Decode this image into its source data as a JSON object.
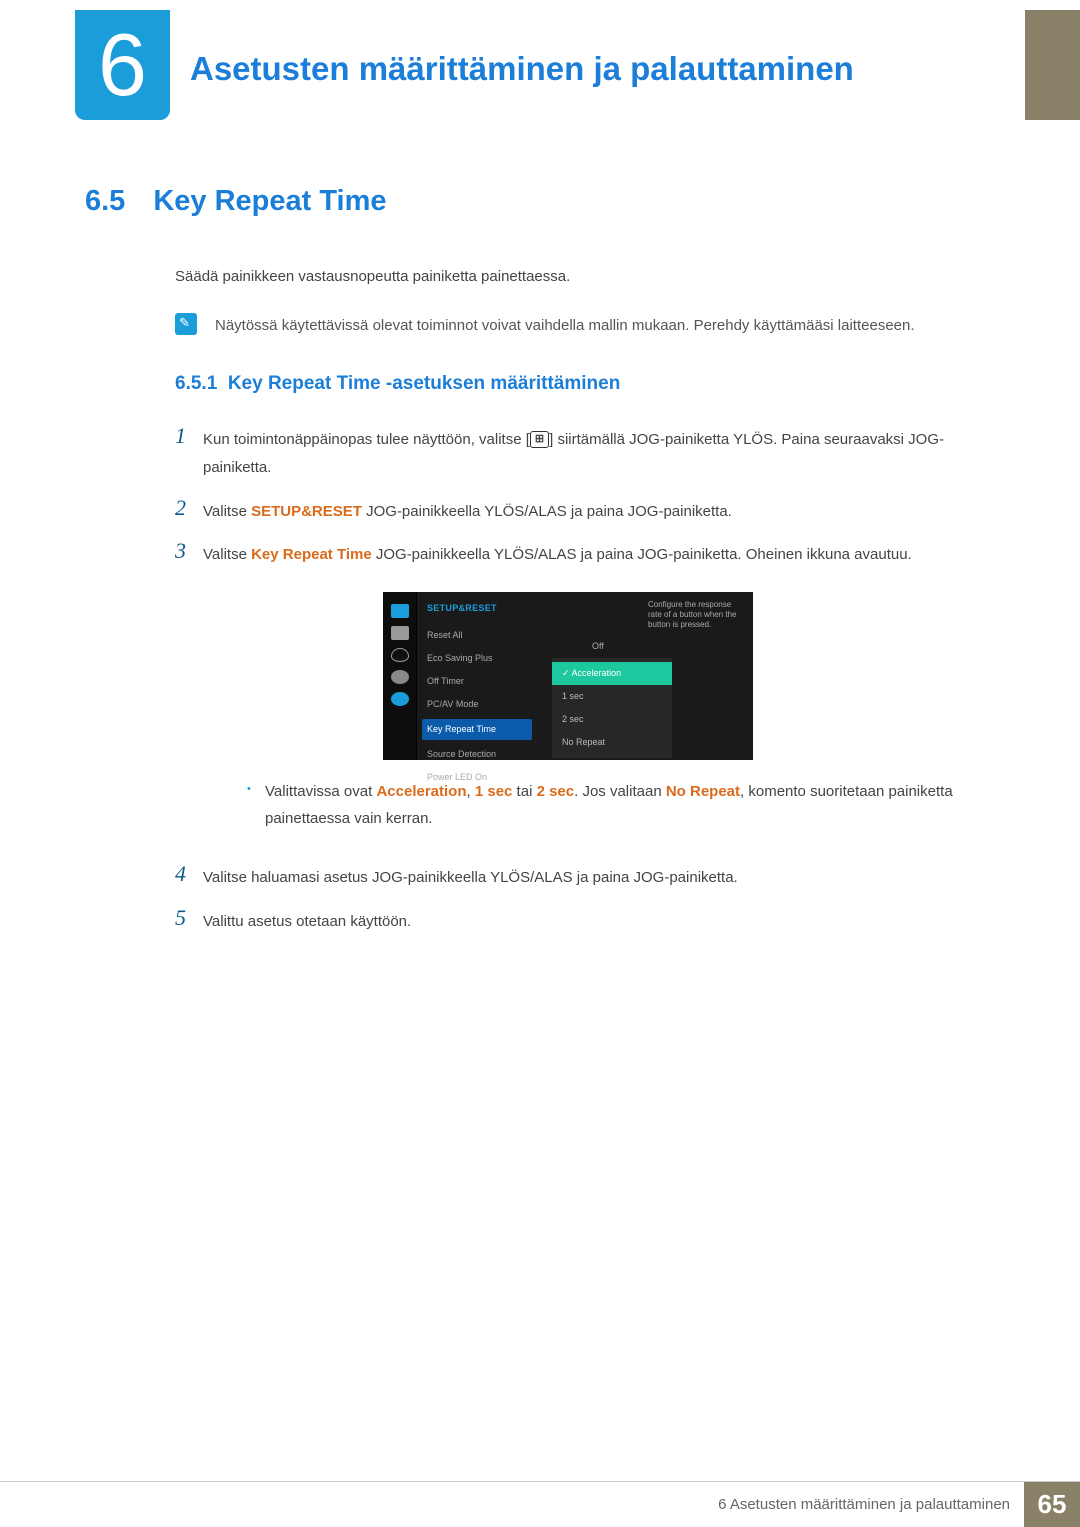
{
  "header": {
    "chapter_number": "6",
    "chapter_title": "Asetusten määrittäminen ja palauttaminen"
  },
  "section": {
    "number": "6.5",
    "title": "Key Repeat Time",
    "intro": "Säädä painikkeen vastausnopeutta painiketta painettaessa.",
    "note": "Näytössä käytettävissä olevat toiminnot voivat vaihdella mallin mukaan. Perehdy käyttämääsi laitteeseen."
  },
  "subsection": {
    "number": "6.5.1",
    "title": "Key Repeat Time -asetuksen määrittäminen"
  },
  "steps": {
    "s1a": "Kun toimintonäppäinopas tulee näyttöön, valitse [",
    "s1b": "] siirtämällä JOG-painiketta YLÖS. Paina seuraavaksi JOG-painiketta.",
    "s2a": "Valitse ",
    "s2_bold": "SETUP&RESET",
    "s2b": " JOG-painikkeella YLÖS/ALAS ja paina JOG-painiketta.",
    "s3a": "Valitse ",
    "s3_orange": "Key Repeat Time",
    "s3b": " JOG-painikkeella YLÖS/ALAS ja paina JOG-painiketta. Oheinen ikkuna avautuu.",
    "bullet_a": "Valittavissa ovat ",
    "bullet_accel": "Acceleration",
    "bullet_comma": ", ",
    "bullet_1sec": "1 sec",
    "bullet_tai": " tai ",
    "bullet_2sec": "2 sec",
    "bullet_jos": ". Jos valitaan ",
    "bullet_norepeat": "No Repeat",
    "bullet_end": ", komento suoritetaan painiketta painettaessa vain kerran.",
    "s4": "Valitse haluamasi asetus JOG-painikkeella YLÖS/ALAS ja paina JOG-painiketta.",
    "s5": "Valittu asetus otetaan käyttöön."
  },
  "osd": {
    "header": "SETUP&RESET",
    "items": [
      "Reset All",
      "Eco Saving Plus",
      "Off Timer",
      "PC/AV Mode",
      "Key Repeat Time",
      "Source Detection",
      "Power LED On"
    ],
    "value_off": "Off",
    "desc": "Configure the response rate of a button when the button is pressed.",
    "options": [
      "Acceleration",
      "1 sec",
      "2 sec",
      "No Repeat"
    ]
  },
  "footer": {
    "text": "6 Asetusten määrittäminen ja palauttaminen",
    "page": "65"
  },
  "jog_glyph": "⊞"
}
